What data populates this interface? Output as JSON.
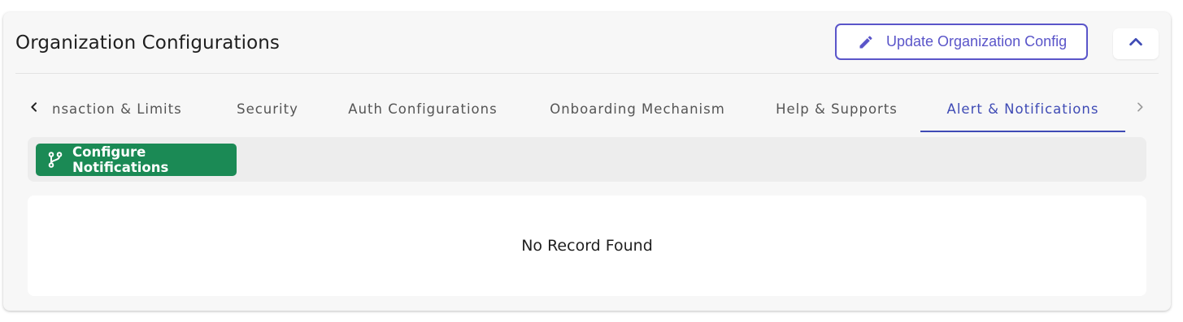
{
  "header": {
    "title": "Organization Configurations",
    "update_button_label": "Update Organization Config",
    "update_icon": "pencil-icon",
    "collapse_icon": "chevron-up-icon"
  },
  "tabs": {
    "items": [
      {
        "label": "nsaction & Limits",
        "active": false
      },
      {
        "label": "Security",
        "active": false
      },
      {
        "label": "Auth Configurations",
        "active": false
      },
      {
        "label": "Onboarding Mechanism",
        "active": false
      },
      {
        "label": "Help & Supports",
        "active": false
      },
      {
        "label": "Alert & Notifications",
        "active": true
      }
    ],
    "scroll_left_icon": "chevron-left-icon",
    "scroll_right_icon": "chevron-right-icon"
  },
  "toolbar": {
    "configure_button_label": "Configure Notifications",
    "configure_icon": "git-branch-icon"
  },
  "content": {
    "empty_message": "No Record Found"
  },
  "colors": {
    "accent": "#3f4bb5",
    "update_button": "#5a55c9",
    "configure_button": "#1b8a55",
    "card_background": "#f7f7f7"
  }
}
